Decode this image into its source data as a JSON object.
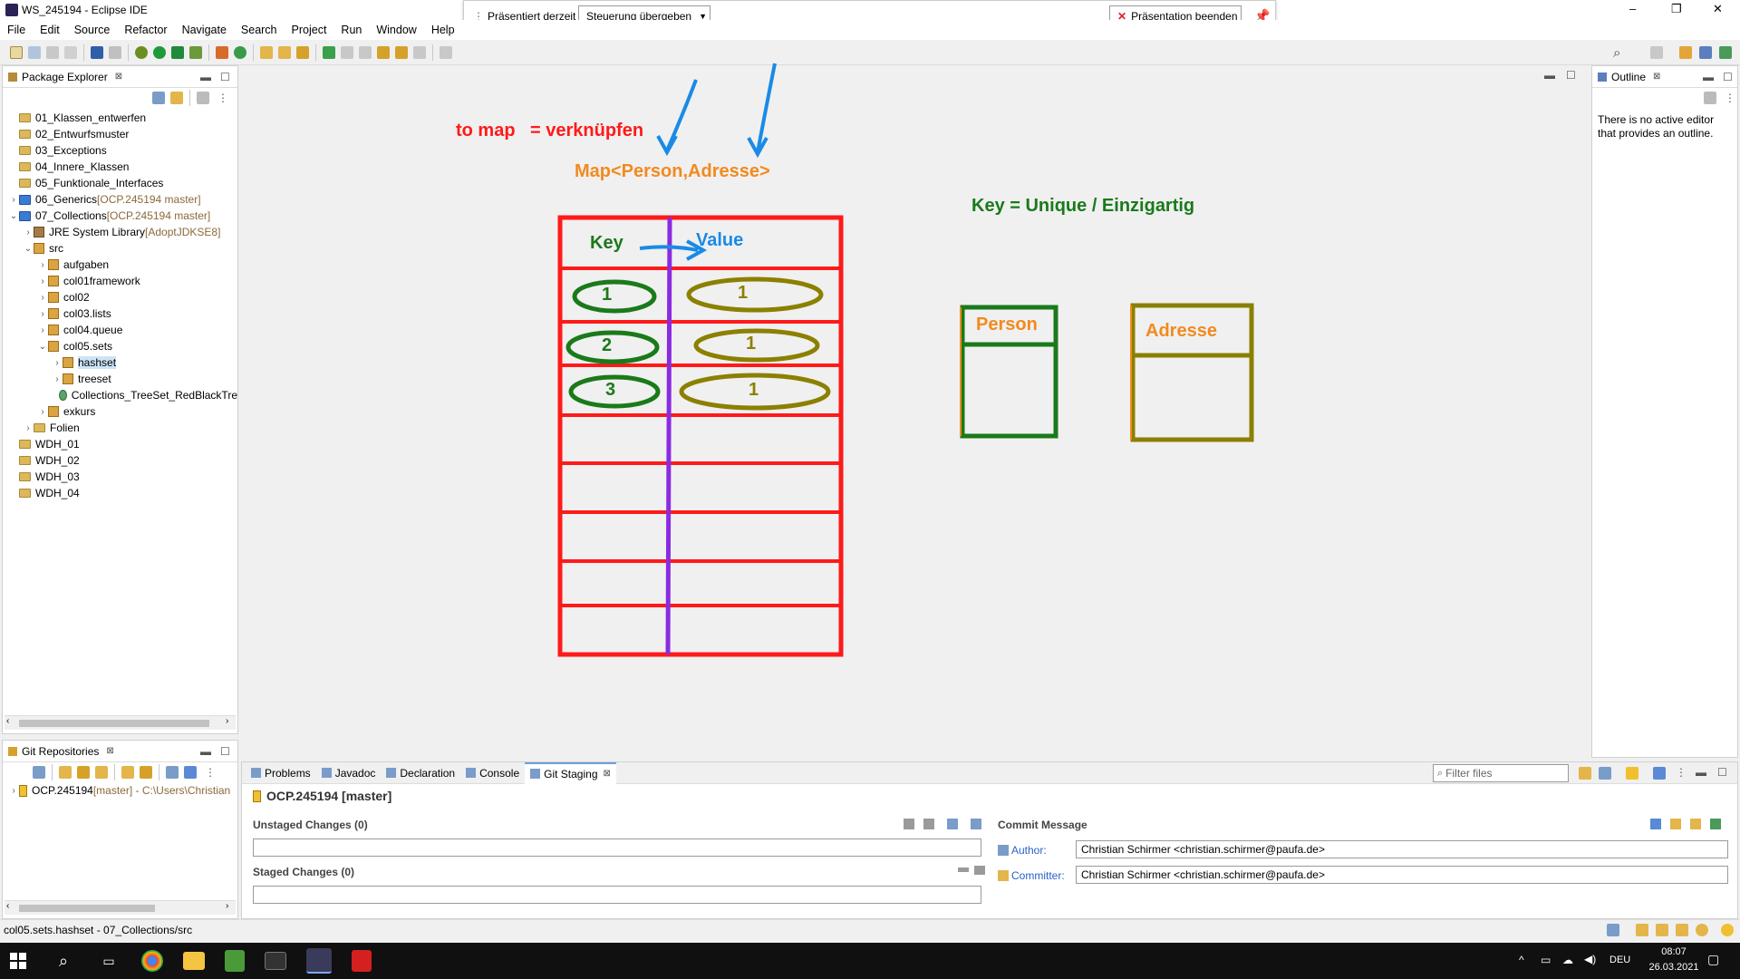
{
  "window": {
    "title": "WS_245194 - Eclipse IDE",
    "min": "–",
    "restore": "❐",
    "close": "✕"
  },
  "presenter": {
    "label": "Präsentiert derzeit",
    "control_button": "Steuerung übergeben",
    "end_button": "Präsentation beenden"
  },
  "menu": [
    "File",
    "Edit",
    "Source",
    "Refactor",
    "Navigate",
    "Search",
    "Project",
    "Run",
    "Window",
    "Help"
  ],
  "package_explorer": {
    "title": "Package Explorer",
    "items": [
      {
        "label": "01_Klassen_entwerfen",
        "dec": "",
        "icon": "project-folder-icon",
        "depth": 0,
        "twisty": ""
      },
      {
        "label": "02_Entwurfsmuster",
        "dec": "",
        "icon": "project-folder-icon",
        "depth": 0,
        "twisty": ""
      },
      {
        "label": "03_Exceptions",
        "dec": "",
        "icon": "project-folder-icon",
        "depth": 0,
        "twisty": ""
      },
      {
        "label": "04_Innere_Klassen",
        "dec": "",
        "icon": "project-folder-icon",
        "depth": 0,
        "twisty": ""
      },
      {
        "label": "05_Funktionale_Interfaces",
        "dec": "",
        "icon": "project-folder-icon",
        "depth": 0,
        "twisty": ""
      },
      {
        "label": "06_Generics",
        "dec": " [OCP.245194 master]",
        "icon": "java-project-icon",
        "depth": 0,
        "twisty": "›"
      },
      {
        "label": "07_Collections",
        "dec": " [OCP.245194 master]",
        "icon": "java-project-icon",
        "depth": 0,
        "twisty": "⌄"
      },
      {
        "label": "JRE System Library",
        "dec": " [AdoptJDKSE8]",
        "icon": "library-icon",
        "depth": 1,
        "twisty": "›"
      },
      {
        "label": "src",
        "dec": "",
        "icon": "source-folder-icon",
        "depth": 1,
        "twisty": "⌄"
      },
      {
        "label": "aufgaben",
        "dec": "",
        "icon": "package-icon",
        "depth": 2,
        "twisty": "›"
      },
      {
        "label": "col01framework",
        "dec": "",
        "icon": "package-icon",
        "depth": 2,
        "twisty": "›"
      },
      {
        "label": "col02",
        "dec": "",
        "icon": "package-icon",
        "depth": 2,
        "twisty": "›"
      },
      {
        "label": "col03.lists",
        "dec": "",
        "icon": "package-icon",
        "depth": 2,
        "twisty": "›"
      },
      {
        "label": "col04.queue",
        "dec": "",
        "icon": "package-icon",
        "depth": 2,
        "twisty": "›"
      },
      {
        "label": "col05.sets",
        "dec": "",
        "icon": "package-icon",
        "depth": 2,
        "twisty": "⌄"
      },
      {
        "label": "hashset",
        "dec": "",
        "icon": "package-icon",
        "depth": 3,
        "twisty": "›",
        "selected": true
      },
      {
        "label": "treeset",
        "dec": "",
        "icon": "package-icon",
        "depth": 3,
        "twisty": "›"
      },
      {
        "label": "Collections_TreeSet_RedBlackTre",
        "dec": "",
        "icon": "java-file-icon",
        "depth": 3,
        "twisty": ""
      },
      {
        "label": "exkurs",
        "dec": "",
        "icon": "package-icon",
        "depth": 2,
        "twisty": "›"
      },
      {
        "label": "Folien",
        "dec": "",
        "icon": "folder-icon",
        "depth": 1,
        "twisty": "›"
      },
      {
        "label": "WDH_01",
        "dec": "",
        "icon": "project-folder-icon",
        "depth": 0,
        "twisty": ""
      },
      {
        "label": "WDH_02",
        "dec": "",
        "icon": "project-folder-icon",
        "depth": 0,
        "twisty": ""
      },
      {
        "label": "WDH_03",
        "dec": "",
        "icon": "project-folder-icon",
        "depth": 0,
        "twisty": ""
      },
      {
        "label": "WDH_04",
        "dec": "",
        "icon": "project-folder-icon",
        "depth": 0,
        "twisty": ""
      }
    ]
  },
  "git_repositories": {
    "title": "Git Repositories",
    "repo": "OCP.245194",
    "repo_dec": " [master] - C:\\Users\\Christian"
  },
  "outline": {
    "title": "Outline",
    "message": "There is no active editor that provides an outline."
  },
  "drawing": {
    "to_map": "to map",
    "verknuepfen": "= verknüpfen",
    "map_type": "Map<Person,Adresse>",
    "key_unique": "Key = Unique / Einzigartig",
    "key_header": "Key",
    "value_header": "Value",
    "keys": [
      "1",
      "2",
      "3"
    ],
    "values": [
      "1",
      "1",
      "1"
    ],
    "person": "Person",
    "adresse": "Adresse"
  },
  "bottom_tabs": [
    "Problems",
    "Javadoc",
    "Declaration",
    "Console",
    "Git Staging"
  ],
  "bottom_tab_icons": [
    "problems-icon",
    "javadoc-icon",
    "declaration-icon",
    "console-icon",
    "git-staging-icon"
  ],
  "git_staging": {
    "filter_placeholder": "Filter files",
    "repo_title": "OCP.245194 [master]",
    "unstaged": "Unstaged Changes (0)",
    "staged": "Staged Changes (0)",
    "commit_message": "Commit Message",
    "author_label": "Author:",
    "author_value": "Christian Schirmer <christian.schirmer@paufa.de>",
    "committer_label": "Committer:",
    "committer_value": "Christian Schirmer <christian.schirmer@paufa.de>"
  },
  "statusbar": {
    "text": "col05.sets.hashset - 07_Collections/src"
  },
  "taskbar": {
    "lang": "DEU",
    "time": "08:07",
    "date": "26.03.2021"
  },
  "colors": {
    "red": "#ff1a1a",
    "purple": "#8a2be2",
    "green": "#1a7a1a",
    "olive": "#8b8000",
    "orange": "#f28a1e",
    "blue": "#1a8ae6"
  }
}
